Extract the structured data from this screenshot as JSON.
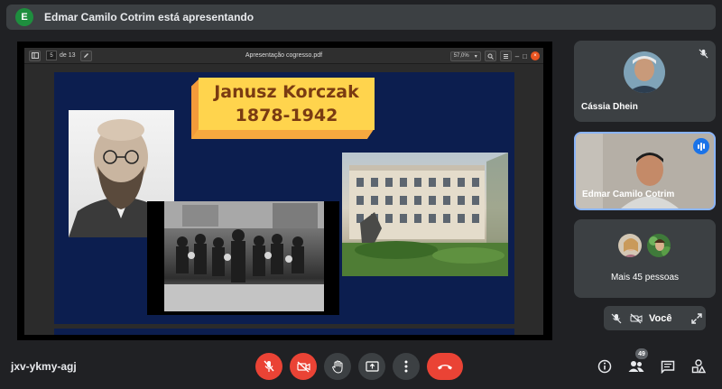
{
  "presenter": {
    "initial": "E",
    "text": "Edmar Camilo Cotrim está apresentando",
    "avatar_color": "#1e8e3e"
  },
  "pdf_viewer": {
    "page_current": "5",
    "page_total_label": "de 13",
    "file_title": "Apresentação cogresso.pdf",
    "zoom": "57,0%"
  },
  "slide": {
    "title_line1": "Janusz Korczak",
    "title_line2": "1878-1942",
    "background": "#0c1e4f"
  },
  "participants": {
    "tile1_name": "Cássia Dhein",
    "tile2_name": "Edmar Camilo Cotrim",
    "tile3_name": "Mais 45 pessoas",
    "self_label": "Você"
  },
  "meeting": {
    "code": "jxv-ykmy-agj",
    "participant_count": "49"
  },
  "icons": {
    "mic_off": "mic-off-icon",
    "cam_off": "camera-off-icon",
    "raise_hand": "raise-hand-icon",
    "present": "present-screen-icon",
    "more": "more-options-icon",
    "hangup": "hang-up-icon",
    "info": "info-icon",
    "people": "people-icon",
    "chat": "chat-icon",
    "activities": "activities-icon",
    "expand": "expand-icon"
  },
  "colors": {
    "danger": "#ea4335",
    "control_bg": "#3c4043",
    "active_border": "#8ab4f8",
    "speaking": "#1a73e8"
  }
}
